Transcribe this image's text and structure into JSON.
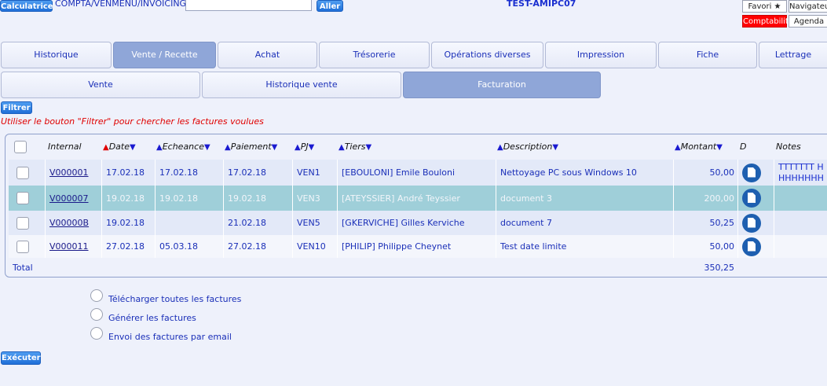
{
  "top": {
    "app_button": "Calculatrice",
    "path": "COMPTA/VENMENU/INVOICING",
    "go_input_value": "",
    "go_button": "Aller",
    "env_title": "TEST-AMIPC07",
    "favori": "Favori ★",
    "navigateur": "Navigateur",
    "comptabilite": "Comptabilité",
    "agenda": "Agenda"
  },
  "tabs": [
    "Historique",
    "Vente / Recette",
    "Achat",
    "Trésorerie",
    "Opérations diverses",
    "Impression",
    "Fiche",
    "Lettrage"
  ],
  "active_tab": "Vente / Recette",
  "subtabs": [
    "Vente",
    "Historique vente",
    "Facturation"
  ],
  "active_subtab": "Facturation",
  "filter_button": "Filtrer",
  "filter_message": "Utiliser le bouton \"Filtrer\" pour chercher les factures voulues",
  "table": {
    "columns": {
      "internal": "Internal",
      "date": "Date",
      "echeance": "Echeance",
      "paiement": "Paiement",
      "pj": "PJ",
      "tiers": "Tiers",
      "description": "Description",
      "montant": "Montant",
      "d": "D",
      "notes": "Notes"
    },
    "rows": [
      {
        "internal": "V000001",
        "date": "17.02.18",
        "echeance": "17.02.18",
        "paiement": "17.02.18",
        "pj": "VEN1",
        "tiers": "[EBOULONI] Emile Bouloni",
        "description": "Nettoyage PC sous Windows 10",
        "montant": "50,00",
        "notes": "TTTTTTTTTTTTTTTT HHHHHHHHHHHH"
      },
      {
        "internal": "V000007",
        "date": "19.02.18",
        "echeance": "19.02.18",
        "paiement": "19.02.18",
        "pj": "VEN3",
        "tiers": "[ATEYSSIER] André Teyssier",
        "description": "document 3",
        "montant": "200,00",
        "notes": ""
      },
      {
        "internal": "V00000B",
        "date": "19.02.18",
        "echeance": "",
        "paiement": "21.02.18",
        "pj": "VEN5",
        "tiers": "[GKERVICHE] Gilles Kerviche",
        "description": "document 7",
        "montant": "50,25",
        "notes": ""
      },
      {
        "internal": "V000011",
        "date": "27.02.18",
        "echeance": "05.03.18",
        "paiement": "27.02.18",
        "pj": "VEN10",
        "tiers": "[PHILIP] Philippe Cheynet",
        "description": "Test date limite",
        "montant": "50,00",
        "notes": ""
      }
    ],
    "total_label": "Total",
    "total_value": "350,25"
  },
  "options": [
    "Télécharger toutes les factures",
    "Générer les factures",
    "Envoi des factures par email"
  ],
  "execute_button": "Exécuter",
  "colors": {
    "background": "#eef1fb",
    "row_light": "#e3e9f8",
    "row_grey": "#9fcfd9",
    "tab_active": "#8fa6d8",
    "message": "#e00000"
  }
}
